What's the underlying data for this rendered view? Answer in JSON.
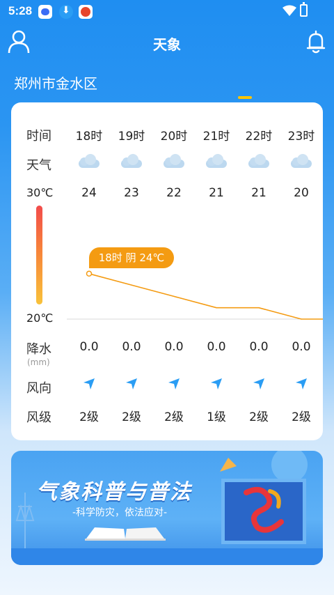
{
  "status_bar": {
    "time": "5:28"
  },
  "header": {
    "title": "天象"
  },
  "location": "郑州市金水区",
  "forecast": {
    "labels": {
      "time": "时间",
      "weather": "天气",
      "rain": "降水",
      "rain_unit": "(mm)",
      "wind_dir": "风向",
      "wind_level": "风级"
    },
    "temp_max_label": "30℃",
    "temp_min_label": "20℃",
    "hours": [
      {
        "time": "18时",
        "weather": "cloudy-icon",
        "temp": "24",
        "rain": "0.0",
        "wind_level": "2级"
      },
      {
        "time": "19时",
        "weather": "cloudy-icon",
        "temp": "23",
        "rain": "0.0",
        "wind_level": "2级"
      },
      {
        "time": "20时",
        "weather": "cloudy-icon",
        "temp": "22",
        "rain": "0.0",
        "wind_level": "2级"
      },
      {
        "time": "21时",
        "weather": "cloudy-icon",
        "temp": "21",
        "rain": "0.0",
        "wind_level": "1级"
      },
      {
        "time": "22时",
        "weather": "cloudy-icon",
        "temp": "21",
        "rain": "0.0",
        "wind_level": "2级"
      },
      {
        "time": "23时",
        "weather": "cloudy-icon",
        "temp": "20",
        "rain": "0.0",
        "wind_level": "2级"
      }
    ],
    "tooltip": "18时 阴 24℃"
  },
  "chart_data": {
    "type": "line",
    "x": [
      "18时",
      "19时",
      "20时",
      "21时",
      "22时",
      "23时"
    ],
    "series": [
      {
        "values": [
          24,
          23,
          22,
          21,
          21,
          20
        ]
      }
    ],
    "ylim": [
      20,
      30
    ]
  },
  "banner": {
    "title": "气象科普与普法",
    "subtitle": "-科学防灾，依法应对-"
  },
  "colors": {
    "primary": "#1f8ef1",
    "accent": "#f49b12",
    "indicator": "#ffc400"
  }
}
